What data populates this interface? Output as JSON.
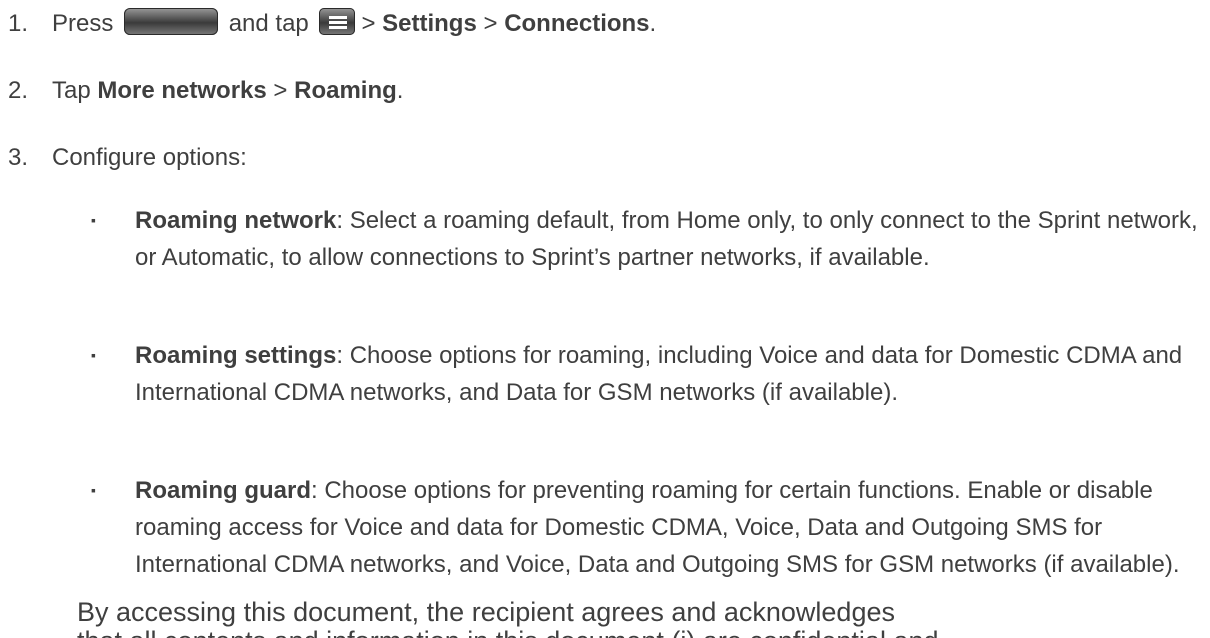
{
  "steps": [
    {
      "num": "1.",
      "press": "Press",
      "and_tap": "and tap",
      "sep1": ">",
      "settings": "Settings",
      "sep2": ">",
      "connections": "Connections",
      "end": "."
    },
    {
      "num": "2.",
      "tap": "Tap",
      "more_networks": "More networks",
      "sep": ">",
      "roaming": "Roaming",
      "end": "."
    },
    {
      "num": "3.",
      "text": "Configure options:"
    }
  ],
  "icons": {
    "home_key": "home-key-icon",
    "menu_key": "menu-key-icon"
  },
  "bullets": [
    {
      "mark": "▪",
      "label": "Roaming network",
      "text": ": Select a roaming default, from Home only, to only connect to the Sprint network, or Automatic, to allow connections to Sprint’s partner  networks, if available."
    },
    {
      "mark": "▪",
      "label": "Roaming settings",
      "text": ": Choose options for roaming, including Voice and data for Domestic CDMA and International CDMA networks, and Data for GSM networks (if available)."
    },
    {
      "mark": "▪",
      "label": "Roaming guard",
      "text": ": Choose options for preventing roaming for certain functions. Enable or disable roaming access for Voice and data for Domestic CDMA, Voice, Data and Outgoing SMS for International CDMA networks, and Voice, Data and Outgoing SMS for GSM networks (if available)."
    }
  ],
  "overlay": {
    "line1": "By accessing this document, the recipient agrees and acknowledges",
    "line2": "that all contents and information in this document (i) are confidential and"
  }
}
